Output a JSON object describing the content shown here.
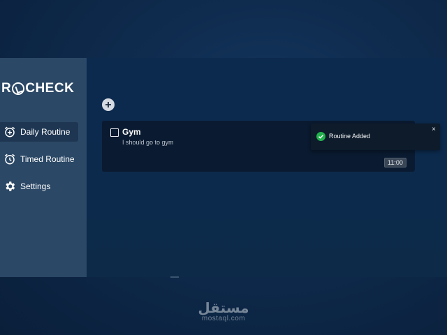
{
  "sidebar": {
    "logo_left": "R",
    "logo_right": "CHECK",
    "items": [
      {
        "label": "Daily Routine",
        "icon": "alarm-add-icon",
        "active": true
      },
      {
        "label": "Timed Routine",
        "icon": "alarm-icon",
        "active": false
      },
      {
        "label": "Settings",
        "icon": "gear-icon",
        "active": false
      }
    ]
  },
  "main": {
    "add_button_icon": "plus-icon",
    "routines": [
      {
        "title": "Gym",
        "description": "I should go to gym",
        "time": "11:00",
        "checked": false
      }
    ]
  },
  "toast": {
    "message": "Routine Added",
    "close": "×",
    "icon": "check-circle-icon",
    "icon_color": "#22b14c"
  },
  "watermark": {
    "arabic": "مستقل",
    "latin": "mostaql.com"
  },
  "colors": {
    "sidebar_bg": "#2b4866",
    "card_bg": "#0a1a30",
    "page_bg": "#0c2a4e"
  }
}
